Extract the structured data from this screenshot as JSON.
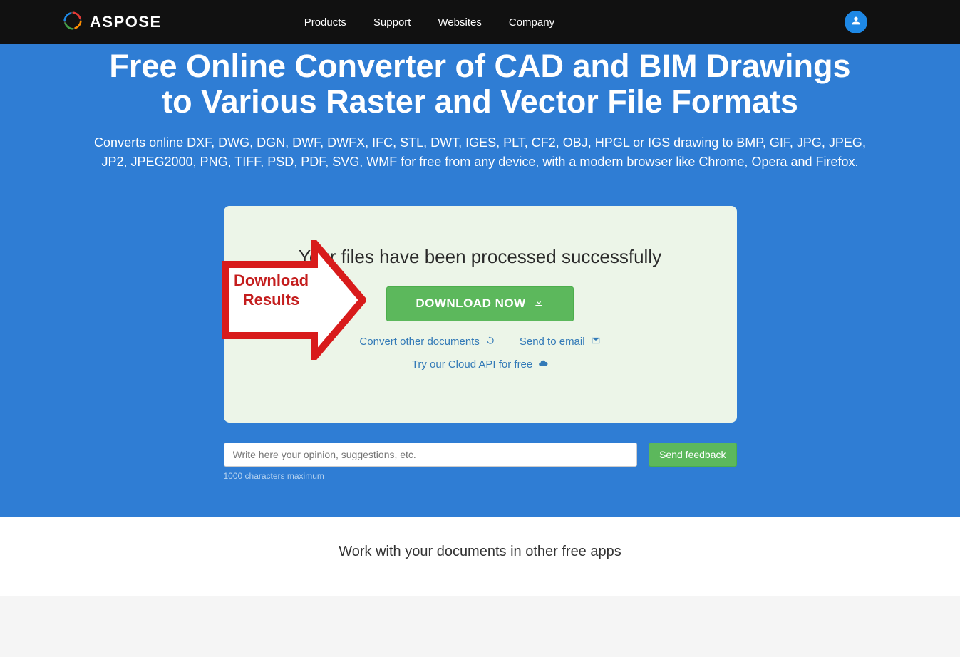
{
  "header": {
    "brand": "ASPOSE",
    "nav": [
      "Products",
      "Support",
      "Websites",
      "Company"
    ]
  },
  "hero": {
    "title": "Free Online Converter of CAD and BIM Drawings to Various Raster and Vector File Formats",
    "subtitle": "Converts online DXF, DWG, DGN, DWF, DWFX, IFC, STL, DWT, IGES, PLT, CF2, OBJ, HPGL or IGS drawing to BMP, GIF, JPG, JPEG, JP2, JPEG2000, PNG, TIFF, PSD, PDF, SVG, WMF for free from any device, with a modern browser like Chrome, Opera and Firefox."
  },
  "card": {
    "status": "Your files have been processed successfully",
    "download_btn": "DOWNLOAD NOW",
    "convert_other": "Convert other documents",
    "send_email": "Send to email",
    "cloud_api": "Try our Cloud API for free"
  },
  "callout": {
    "line1": "Download",
    "line2": "Results"
  },
  "feedback": {
    "placeholder": "Write here your opinion, suggestions, etc.",
    "send": "Send feedback",
    "limit": "1000 characters maximum"
  },
  "bottom": {
    "heading": "Work with your documents in other free apps"
  }
}
